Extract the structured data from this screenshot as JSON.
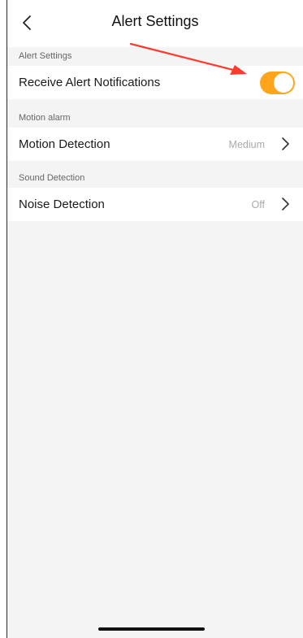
{
  "header": {
    "back_icon": "chevron-left-icon",
    "title": "Alert Settings"
  },
  "sections": [
    {
      "label": "Alert Settings",
      "row": {
        "label": "Receive Alert Notifications",
        "toggle_on": true,
        "toggle_color": "#ffa51c"
      }
    },
    {
      "label": "Motion alarm",
      "row": {
        "label": "Motion Detection",
        "value": "Medium",
        "icon": "chevron-right-icon"
      }
    },
    {
      "label": "Sound Detection",
      "row": {
        "label": "Noise Detection",
        "value": "Off",
        "icon": "chevron-right-icon"
      }
    }
  ],
  "annotation": {
    "arrow_color": "#ff3b2f"
  }
}
